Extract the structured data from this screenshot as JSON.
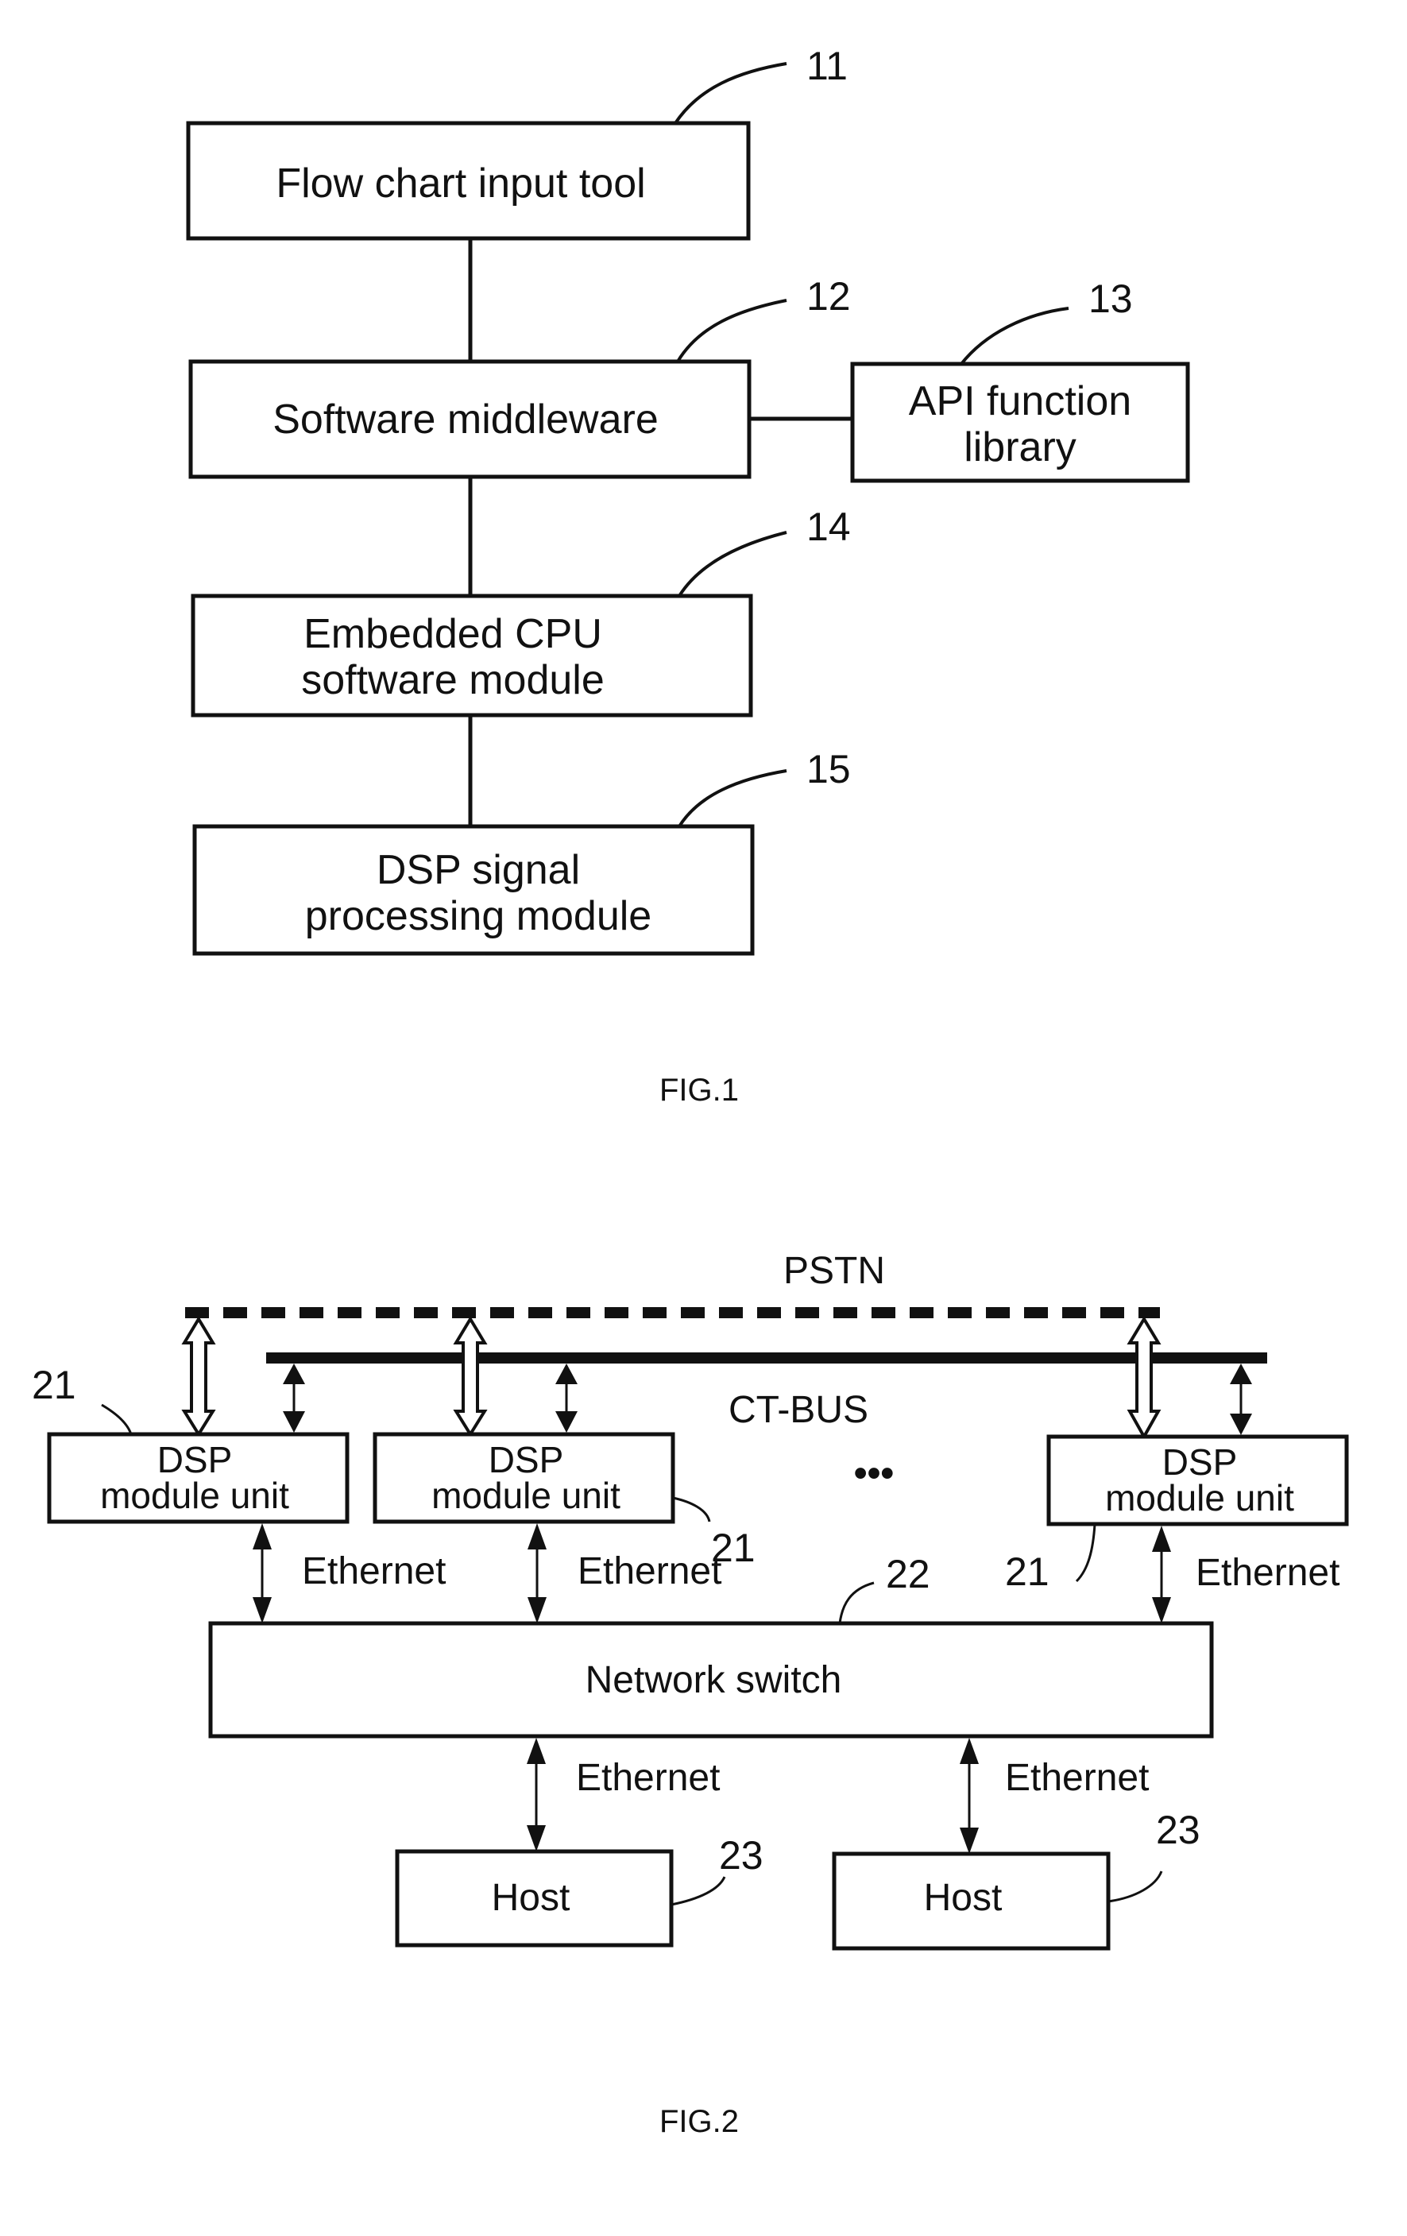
{
  "fig1": {
    "caption": "FIG.1",
    "blocks": [
      {
        "ref": "11",
        "lines": [
          "Flow chart input tool"
        ]
      },
      {
        "ref": "12",
        "lines": [
          "Software middleware"
        ]
      },
      {
        "ref": "13",
        "lines": [
          "API function",
          "library"
        ]
      },
      {
        "ref": "14",
        "lines": [
          "Embedded CPU",
          "software module"
        ]
      },
      {
        "ref": "15",
        "lines": [
          "DSP signal",
          "processing module"
        ]
      }
    ],
    "connections": [
      [
        "11",
        "12"
      ],
      [
        "12",
        "13"
      ],
      [
        "12",
        "14"
      ],
      [
        "14",
        "15"
      ]
    ]
  },
  "fig2": {
    "caption": "FIG.2",
    "pstn_label": "PSTN",
    "ctbus_label": "CT-BUS",
    "ellipsis": "•••",
    "dsp_units": [
      {
        "ref": "21",
        "lines": [
          "DSP",
          "module unit"
        ],
        "link_label": "Ethernet"
      },
      {
        "ref": "21",
        "lines": [
          "DSP",
          "module unit"
        ],
        "link_label": "Ethernet"
      },
      {
        "ref": "21",
        "lines": [
          "DSP",
          "module unit"
        ],
        "link_label": "Ethernet"
      }
    ],
    "switch": {
      "ref": "22",
      "label": "Network switch"
    },
    "hosts": [
      {
        "ref": "23",
        "label": "Host",
        "link_label": "Ethernet"
      },
      {
        "ref": "23",
        "label": "Host",
        "link_label": "Ethernet"
      }
    ]
  }
}
